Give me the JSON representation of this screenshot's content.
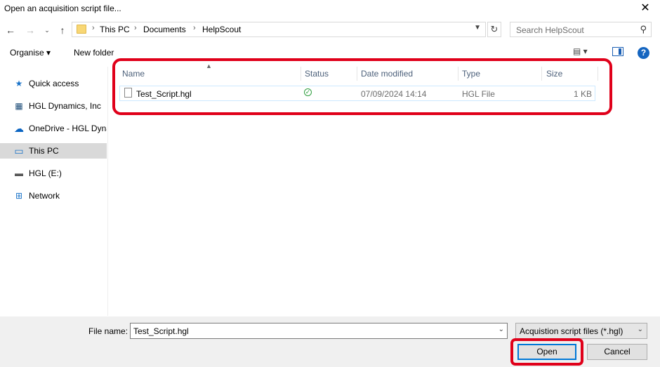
{
  "window": {
    "title": "Open an acquisition script file...",
    "close_glyph": "✕"
  },
  "nav": {
    "back": "←",
    "forward": "→",
    "recent": "⌄",
    "up": "↑",
    "refresh": "↻"
  },
  "address": {
    "crumbs": [
      "This PC",
      "Documents",
      "HelpScout"
    ],
    "separator": "›"
  },
  "search": {
    "placeholder": "Search HelpScout"
  },
  "toolbar": {
    "organise": "Organise ▾",
    "new_folder": "New folder",
    "view_icon": "▤ ▾",
    "help": "?"
  },
  "sidebar": {
    "items": [
      {
        "label": "Quick access",
        "icon": "★"
      },
      {
        "label": "HGL Dynamics, Inc",
        "icon": "▦"
      },
      {
        "label": "OneDrive - HGL Dyna",
        "icon": "☁"
      },
      {
        "label": "This PC",
        "icon": "▭",
        "selected": true
      },
      {
        "label": "HGL (E:)",
        "icon": "▬"
      },
      {
        "label": "Network",
        "icon": "⊞"
      }
    ]
  },
  "file_list": {
    "columns": [
      "Name",
      "Status",
      "Date modified",
      "Type",
      "Size"
    ],
    "rows": [
      {
        "name": "Test_Script.hgl",
        "status": "synced",
        "date_modified": "07/09/2024 14:14",
        "type": "HGL File",
        "size": "1 KB"
      }
    ]
  },
  "bottom": {
    "file_name_label": "File name:",
    "file_name_value": "Test_Script.hgl",
    "filter_value": "Acquistion script files (*.hgl)",
    "open_label": "Open",
    "cancel_label": "Cancel"
  },
  "colors": {
    "annotation": "#e0001a",
    "accent": "#0078d7",
    "selected_row": "#cce8ff"
  }
}
